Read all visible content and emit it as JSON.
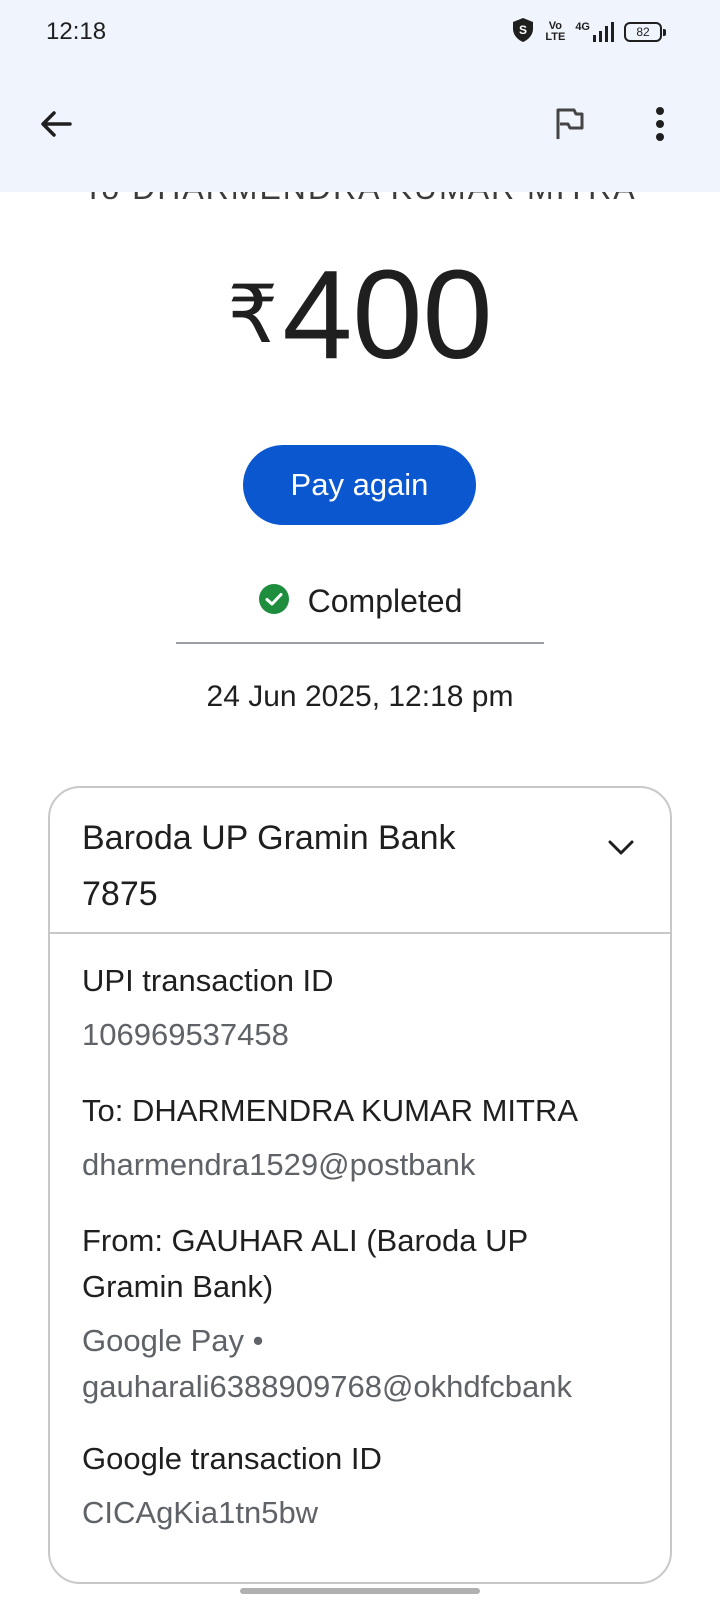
{
  "status_bar": {
    "time": "12:18",
    "volte_top": "Vo",
    "volte_bottom": "LTE",
    "network": "4G",
    "battery": "82"
  },
  "app_bar": {
    "back_icon": "arrow-left-icon",
    "flag_icon": "flag-icon",
    "menu_icon": "more-vert-icon"
  },
  "header_cutoff": "To DHARMENDRA KUMAR MITRA",
  "amount": {
    "currency": "₹",
    "value": "400"
  },
  "pay_again_label": "Pay again",
  "status": {
    "label": "Completed",
    "color": "#1e8e3e"
  },
  "datetime": "24 Jun 2025, 12:18 pm",
  "card": {
    "bank_name": "Baroda UP Gramin Bank",
    "account_suffix": "7875",
    "fields": [
      {
        "label": "UPI transaction ID",
        "value": "106969537458"
      },
      {
        "label": "To: DHARMENDRA KUMAR MITRA",
        "value": "dharmendra1529@postbank"
      },
      {
        "label_line1": "From: GAUHAR ALI (Baroda UP",
        "label_line2": "Gramin Bank)",
        "value_line1": "Google Pay •",
        "value_line2": "gauharali6388909768@okhdfcbank"
      },
      {
        "label": "Google transaction ID",
        "value": "CICAgKia1tn5bw"
      }
    ]
  },
  "colors": {
    "accent": "#0b57d0",
    "appbar_bg": "#f0f4fc"
  }
}
